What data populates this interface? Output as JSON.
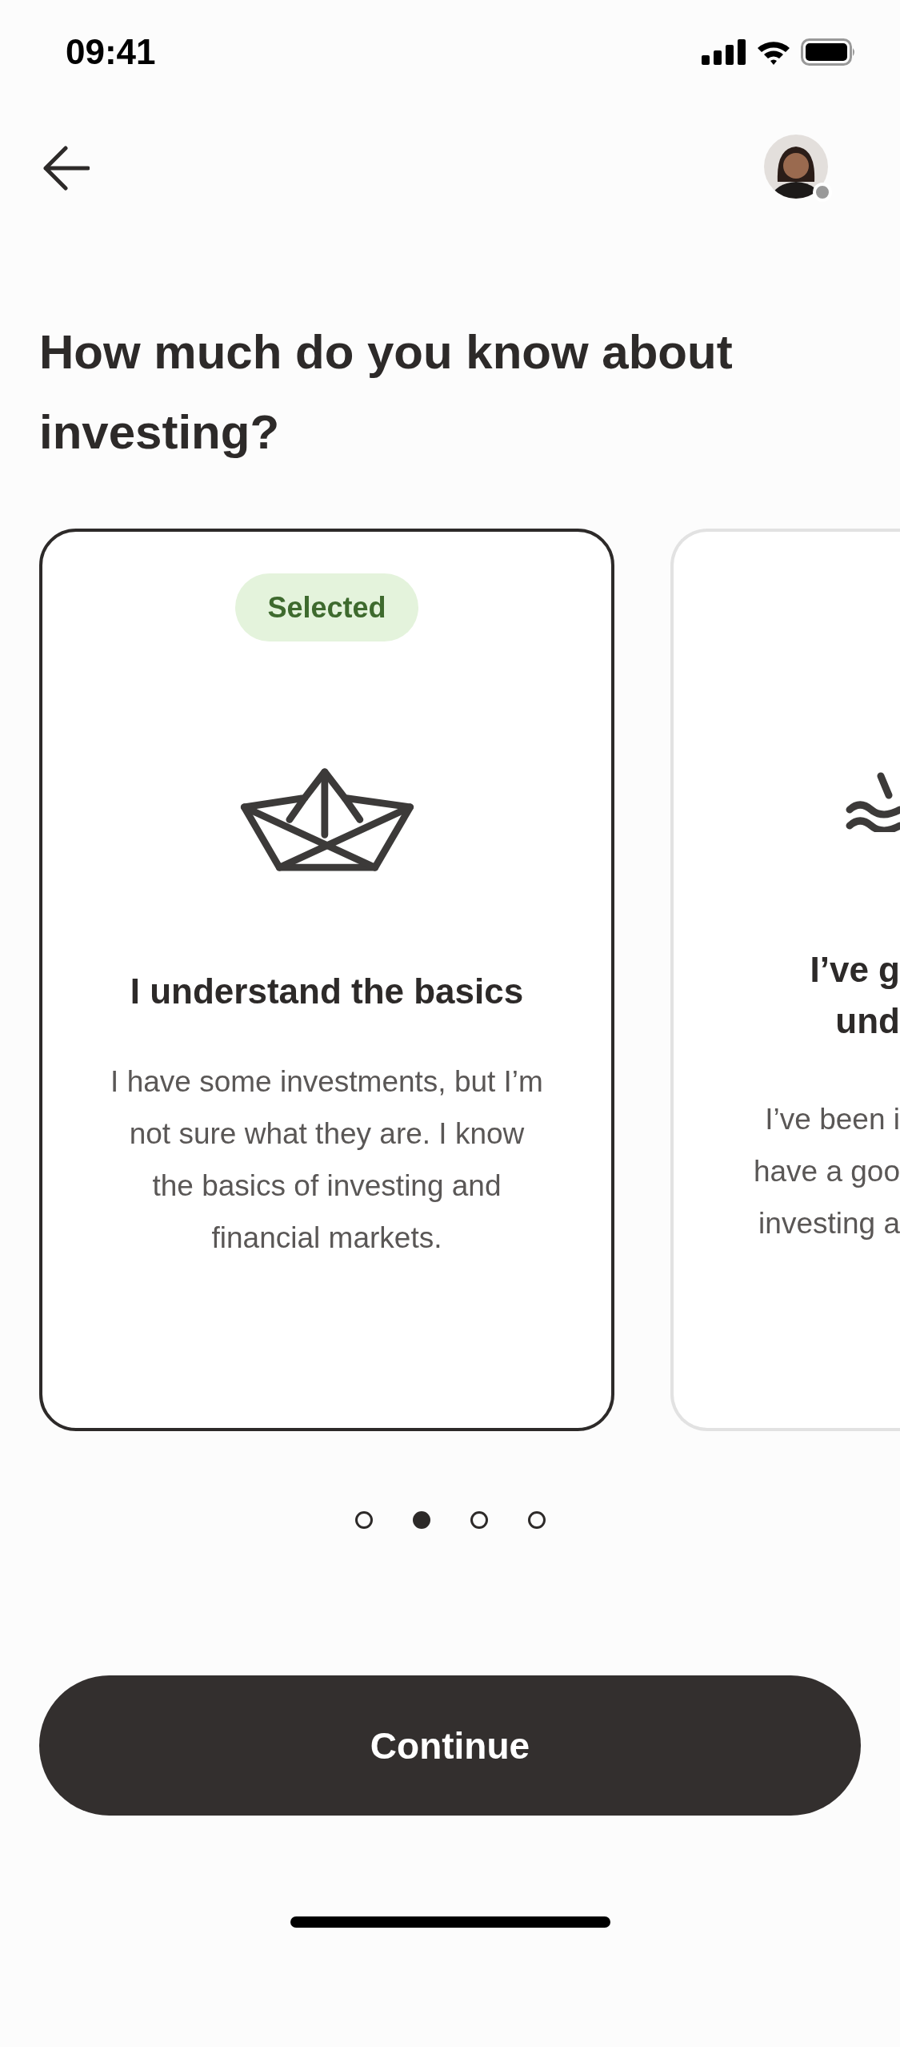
{
  "status_bar": {
    "time": "09:41"
  },
  "heading": "How much do you know about investing?",
  "cards": [
    {
      "kind": "full",
      "selected": true,
      "badge": "Selected",
      "title_lines": [
        "I understand the basics"
      ],
      "description_lines": [
        "I have some investments, but I’m",
        "not sure what they are. I know",
        "the basics of investing and",
        "financial markets."
      ]
    },
    {
      "kind": "peek",
      "selected": false,
      "title_lines": [
        "I’ve g",
        "und"
      ],
      "description_lines": [
        "I’ve been i",
        "have a goo",
        "investing a"
      ]
    }
  ],
  "dots": [
    {
      "selected": false
    },
    {
      "selected": true
    },
    {
      "selected": false
    },
    {
      "selected": false
    }
  ],
  "continue_button": "Continue"
}
